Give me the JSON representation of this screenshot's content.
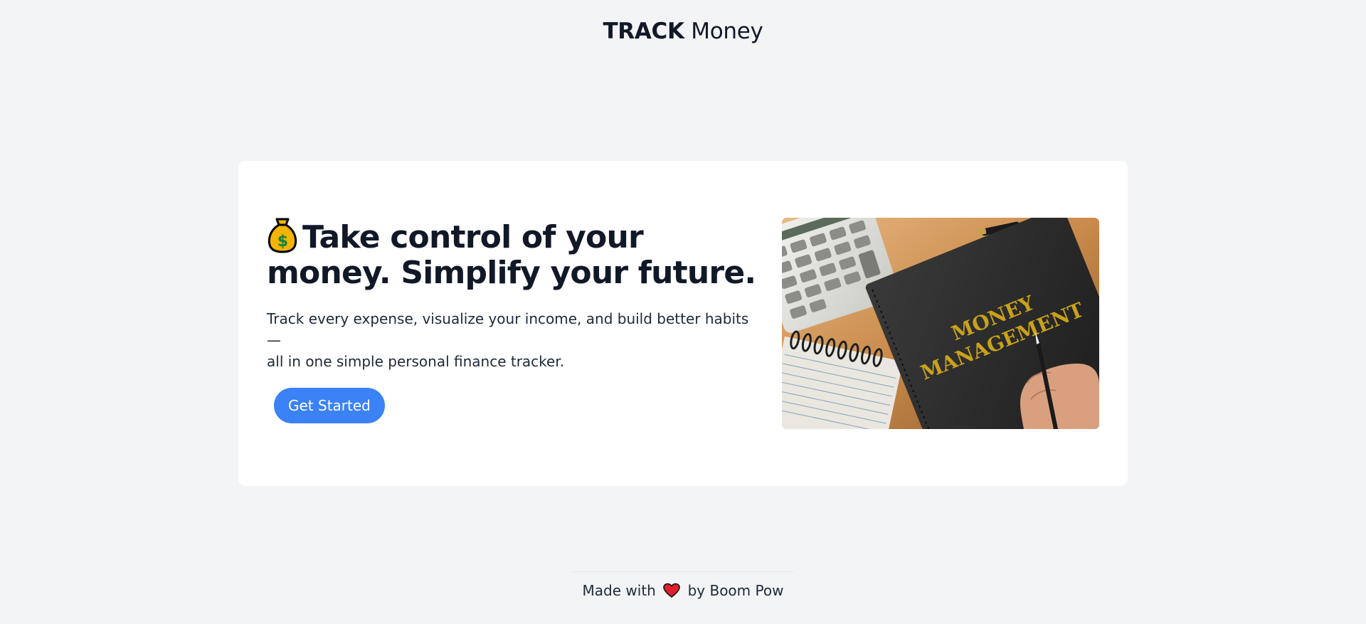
{
  "header": {
    "logo_bold": "TRACK",
    "logo_light": "Money"
  },
  "hero": {
    "icon": "money-bag-icon",
    "headline_line1": "Take control of your",
    "headline_line2": "money. Simplify your future.",
    "subtitle_line1": "Track every expense, visualize your income, and build better habits—",
    "subtitle_line2": "all in one simple personal finance tracker.",
    "cta_label": "Get Started",
    "image_text_line1": "MONEY",
    "image_text_line2": "MANAGEMENT"
  },
  "footer": {
    "prefix": "Made with",
    "icon": "heart-icon",
    "suffix": "by Boom Pow"
  },
  "colors": {
    "background": "#f3f4f6",
    "card": "#ffffff",
    "accent": "#3b82f6",
    "text": "#111827"
  }
}
